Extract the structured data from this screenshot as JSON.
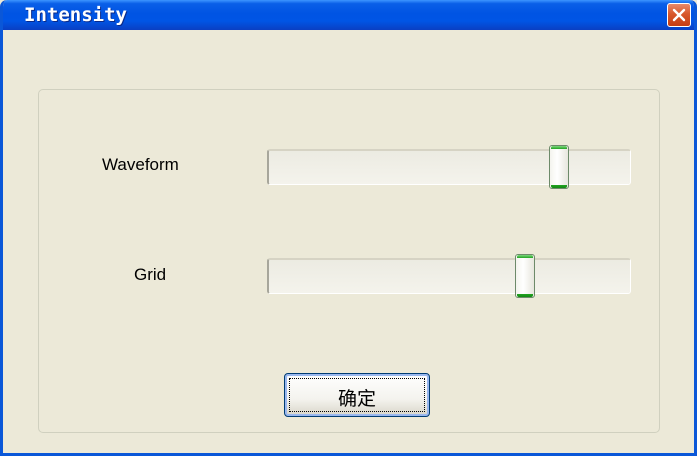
{
  "window": {
    "title": "Intensity"
  },
  "icons": {
    "close": "close-icon"
  },
  "sliders": [
    {
      "label": "Waveform",
      "value_fraction": 0.82
    },
    {
      "label": "Grid",
      "value_fraction": 0.72
    }
  ],
  "buttons": {
    "ok_label": "确定"
  },
  "colors": {
    "titlebar": "#0054e3",
    "window_bg": "#ece9d8",
    "close_button": "#d8582c",
    "slider_thumb_accent": "#21a321"
  }
}
